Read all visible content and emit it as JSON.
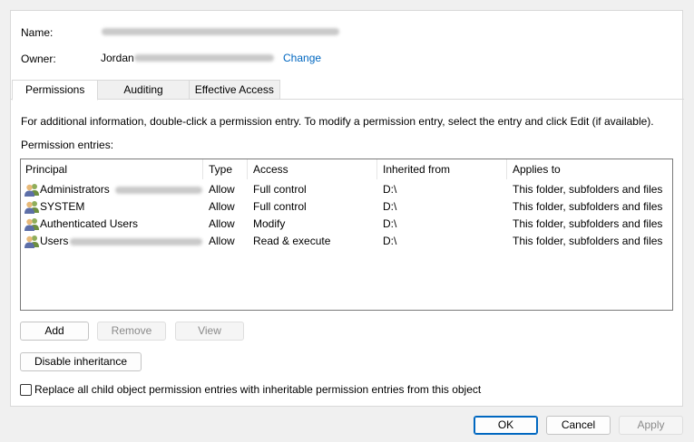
{
  "header": {
    "name_label": "Name:",
    "owner_label": "Owner:",
    "owner_value": "Jordan",
    "change_link": "Change"
  },
  "tabs": [
    {
      "label": "Permissions",
      "active": true
    },
    {
      "label": "Auditing",
      "active": false
    },
    {
      "label": "Effective Access",
      "active": false
    }
  ],
  "info_text": "For additional information, double-click a permission entry. To modify a permission entry, select the entry and click Edit (if available).",
  "entries_label": "Permission entries:",
  "columns": [
    "Principal",
    "Type",
    "Access",
    "Inherited from",
    "Applies to"
  ],
  "entries": [
    {
      "principal": "Administrators",
      "type": "Allow",
      "access": "Full control",
      "inherited": "D:\\",
      "applies": "This folder, subfolders and files"
    },
    {
      "principal": "SYSTEM",
      "type": "Allow",
      "access": "Full control",
      "inherited": "D:\\",
      "applies": "This folder, subfolders and files"
    },
    {
      "principal": "Authenticated Users",
      "type": "Allow",
      "access": "Modify",
      "inherited": "D:\\",
      "applies": "This folder, subfolders and files"
    },
    {
      "principal": "Users",
      "type": "Allow",
      "access": "Read & execute",
      "inherited": "D:\\",
      "applies": "This folder, subfolders and files"
    }
  ],
  "buttons": {
    "add": "Add",
    "remove": "Remove",
    "view": "View",
    "disable_inheritance": "Disable inheritance",
    "ok": "OK",
    "cancel": "Cancel",
    "apply": "Apply"
  },
  "replace_checkbox": {
    "label": "Replace all child object permission entries with inheritable permission entries from this object",
    "checked": false
  },
  "icons": {
    "principal": "users-group-icon"
  },
  "colors": {
    "link": "#0067c0",
    "ok_border": "#0067c0"
  }
}
